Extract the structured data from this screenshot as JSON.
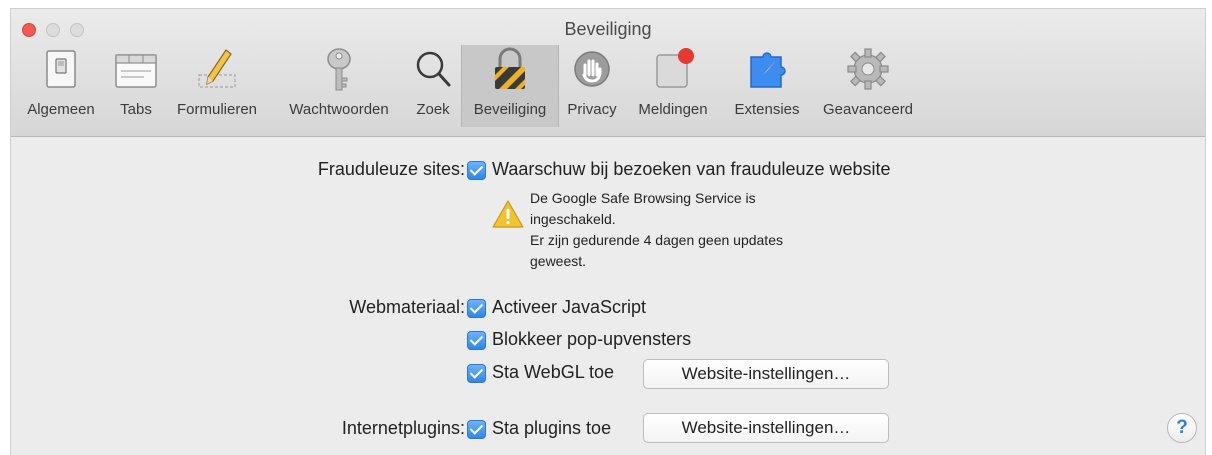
{
  "window": {
    "title": "Beveiliging"
  },
  "toolbar": {
    "tabs": [
      {
        "label": "Algemeen",
        "icon": "switch-icon"
      },
      {
        "label": "Tabs",
        "icon": "tabs-icon"
      },
      {
        "label": "Formulieren",
        "icon": "pencil-icon"
      },
      {
        "label": "Wachtwoorden",
        "icon": "key-icon"
      },
      {
        "label": "Zoek",
        "icon": "magnifier-icon"
      },
      {
        "label": "Beveiliging",
        "icon": "padlock-icon",
        "active": true
      },
      {
        "label": "Privacy",
        "icon": "hand-icon"
      },
      {
        "label": "Meldingen",
        "icon": "notification-icon"
      },
      {
        "label": "Extensies",
        "icon": "puzzle-compass-icon"
      },
      {
        "label": "Geavanceerd",
        "icon": "gear-icon"
      }
    ]
  },
  "fraud": {
    "label": "Frauduleuze sites:",
    "checkbox": {
      "label": "Waarschuw bij bezoeken van frauduleuze website",
      "checked": true
    },
    "warning": {
      "icon": "warning-icon",
      "lines": [
        "De Google Safe Browsing Service is",
        "ingeschakeld.",
        "Er zijn gedurende 4 dagen geen updates",
        "geweest."
      ]
    }
  },
  "web": {
    "label": "Webmateriaal:",
    "js": {
      "label": "Activeer JavaScript",
      "checked": true
    },
    "popups": {
      "label": "Blokkeer pop-upvensters",
      "checked": true
    },
    "webgl": {
      "label": "Sta WebGL toe",
      "checked": true
    },
    "webgl_button": "Website-instellingen…"
  },
  "plugins": {
    "label": "Internetplugins:",
    "allow": {
      "label": "Sta plugins toe",
      "checked": true
    },
    "button": "Website-instellingen…"
  },
  "help": {
    "label": "?"
  },
  "colors": {
    "accent": "#2f86e8",
    "close": "#f25a55",
    "warning": "#f2c230"
  }
}
